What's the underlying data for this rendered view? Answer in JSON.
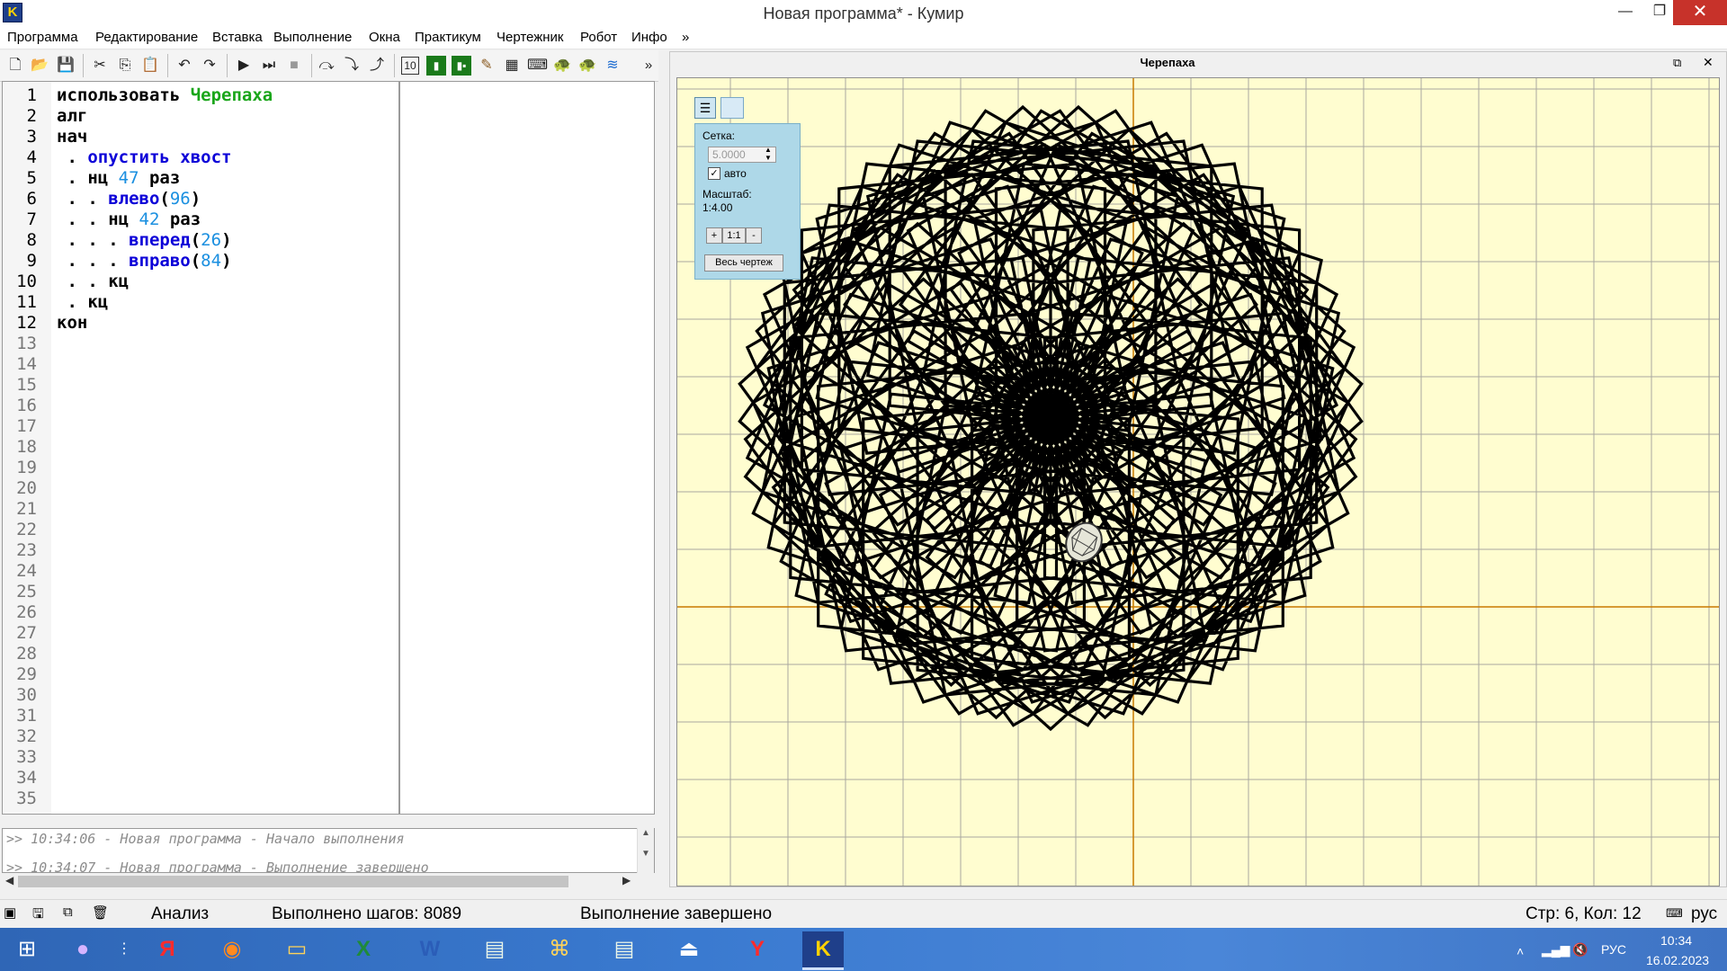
{
  "window": {
    "title": "Новая программа* - Кумир",
    "icon_letter": "K",
    "minimize": "—",
    "maximize": "❐",
    "close": "✕"
  },
  "menu": [
    "Программа",
    "Редактирование",
    "Вставка",
    "Выполнение",
    "Окна",
    "Практикум",
    "Чертежник",
    "Робот",
    "Инфо",
    "»"
  ],
  "toolbar_overflow": "»",
  "editor": {
    "line_numbers": [
      "1",
      "2",
      "3",
      "4",
      "5",
      "6",
      "7",
      "8",
      "9",
      "10",
      "11",
      "12",
      "13",
      "14",
      "15",
      "16",
      "17",
      "18",
      "19",
      "20",
      "21",
      "22",
      "23",
      "24",
      "25",
      "26",
      "27",
      "28",
      "29",
      "30",
      "31",
      "32",
      "33",
      "34",
      "35"
    ],
    "lines": [
      {
        "indent": "",
        "parts": [
          {
            "t": "использовать ",
            "c": ""
          },
          {
            "t": "Черепаха",
            "c": "kw-green"
          }
        ]
      },
      {
        "indent": "",
        "parts": [
          {
            "t": "алг",
            "c": ""
          }
        ]
      },
      {
        "indent": "",
        "parts": [
          {
            "t": "нач",
            "c": ""
          }
        ]
      },
      {
        "indent": " . ",
        "parts": [
          {
            "t": "опустить хвост",
            "c": "kw-blue"
          }
        ]
      },
      {
        "indent": " . ",
        "parts": [
          {
            "t": "нц ",
            "c": ""
          },
          {
            "t": "47",
            "c": "num"
          },
          {
            "t": " раз",
            "c": ""
          }
        ]
      },
      {
        "indent": " . . ",
        "parts": [
          {
            "t": "влево",
            "c": "kw-blue"
          },
          {
            "t": "(",
            "c": ""
          },
          {
            "t": "96",
            "c": "num"
          },
          {
            "t": ")",
            "c": ""
          }
        ]
      },
      {
        "indent": " . . ",
        "parts": [
          {
            "t": "нц ",
            "c": ""
          },
          {
            "t": "42",
            "c": "num"
          },
          {
            "t": " раз",
            "c": ""
          }
        ]
      },
      {
        "indent": " . . . ",
        "parts": [
          {
            "t": "вперед",
            "c": "kw-blue"
          },
          {
            "t": "(",
            "c": ""
          },
          {
            "t": "26",
            "c": "num"
          },
          {
            "t": ")",
            "c": ""
          }
        ]
      },
      {
        "indent": " . . . ",
        "parts": [
          {
            "t": "вправо",
            "c": "kw-blue"
          },
          {
            "t": "(",
            "c": ""
          },
          {
            "t": "84",
            "c": "num"
          },
          {
            "t": ")",
            "c": ""
          }
        ]
      },
      {
        "indent": " . . ",
        "parts": [
          {
            "t": "кц",
            "c": ""
          }
        ]
      },
      {
        "indent": " . ",
        "parts": [
          {
            "t": "кц",
            "c": ""
          }
        ]
      },
      {
        "indent": "",
        "parts": [
          {
            "t": "кон",
            "c": ""
          }
        ]
      }
    ]
  },
  "console": {
    "lines": [
      ">> 10:34:06 - Новая программа - Начало выполнения",
      ">> 10:34:07 - Новая программа - Выполнение завершено"
    ]
  },
  "turtle": {
    "title": "Черепаха",
    "grid_label": "Сетка:",
    "grid_value": "5.0000",
    "auto_label": "авто",
    "auto_checked": true,
    "scale_label": "Масштаб:",
    "scale_value": "1:4.00",
    "zoom_in": "+",
    "zoom_reset": "1:1",
    "zoom_out": "-",
    "fit_button": "Весь чертеж",
    "drawing": {
      "outer_repeats": 47,
      "left_turn": 96,
      "inner_repeats": 42,
      "step": 26,
      "right_turn": 84
    }
  },
  "status": {
    "mode": "Анализ",
    "steps": "Выполнено шагов: 8089",
    "state": "Выполнение завершено",
    "position": "Стр: 6, Кол: 12",
    "keyboard_layout": "рус"
  },
  "taskbar": {
    "lang": "РУС",
    "time": "10:34",
    "date": "16.02.2023"
  },
  "colors": {
    "canvas_bg": "#fffdd0",
    "axis": "#c87a00",
    "green_keyword": "#1aa61a",
    "blue_keyword": "#0c00d8",
    "number": "#1a8fe0",
    "close_button": "#c7322a"
  }
}
